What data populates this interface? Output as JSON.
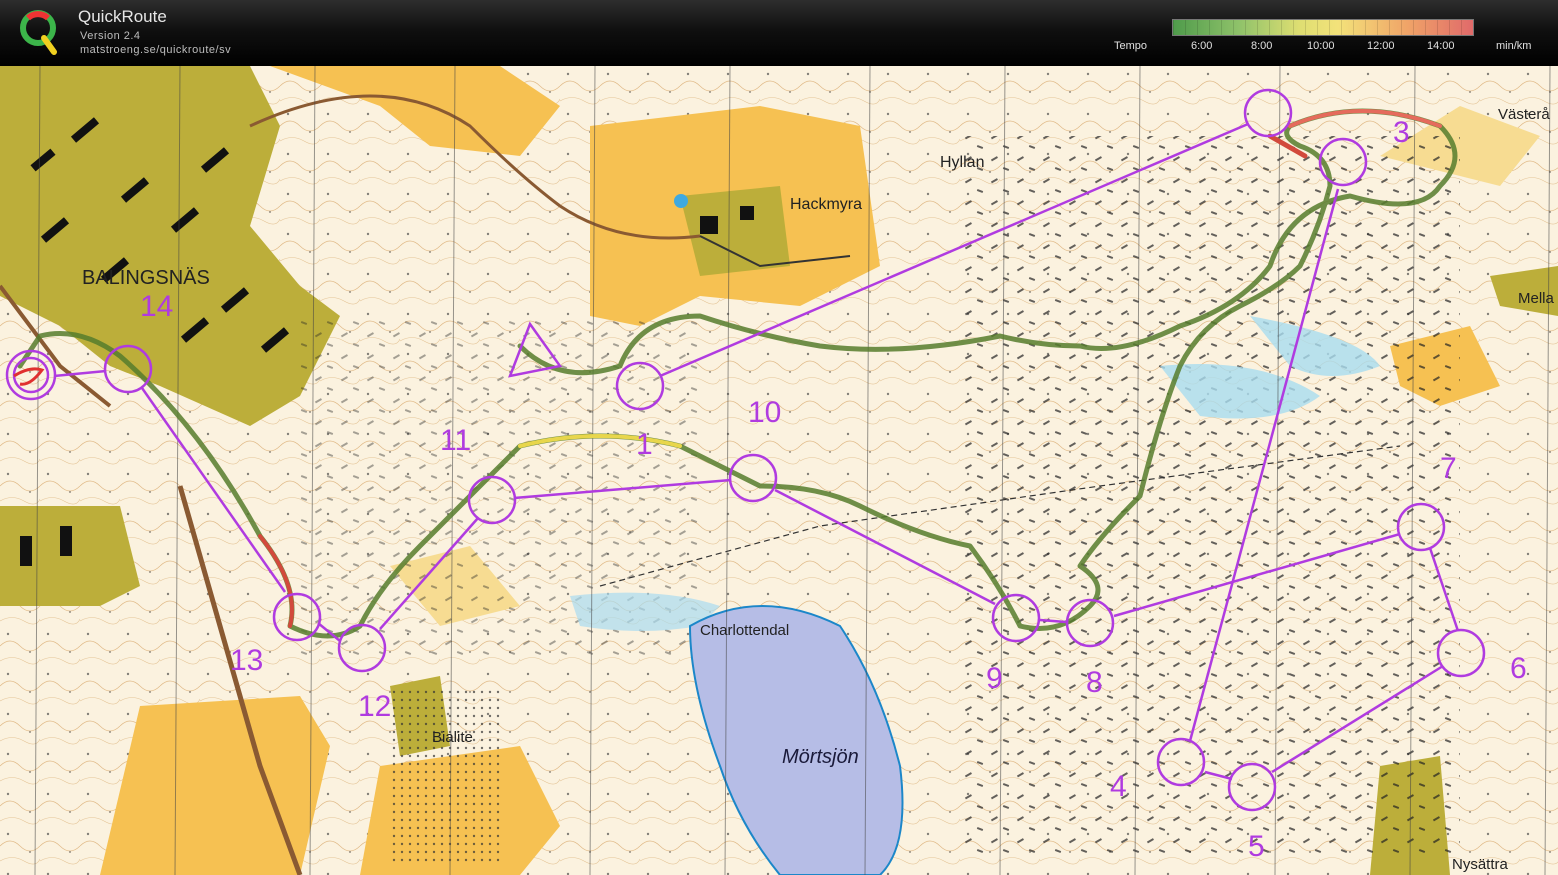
{
  "app": {
    "name": "QuickRoute",
    "version": "Version 2.4",
    "url": "matstroeng.se/quickroute/sv"
  },
  "legend": {
    "title": "Tempo",
    "ticks": [
      "6:00",
      "8:00",
      "10:00",
      "12:00",
      "14:00"
    ],
    "unit": "min/km",
    "colors": {
      "slow": "#e06a6a",
      "mid": "#f3e27a",
      "fast": "#4f9b4b"
    }
  },
  "map": {
    "places": [
      "BALINGSNÄS",
      "Hackmyra",
      "Hyllan",
      "Charlottendal",
      "Mörtsjön",
      "Bialite",
      "Västerå",
      "Mella",
      "Nysättra"
    ],
    "controls": [
      "1",
      "3",
      "4",
      "5",
      "6",
      "7",
      "8",
      "9",
      "10",
      "11",
      "12",
      "13",
      "14"
    ],
    "course_color": "#b03be0"
  }
}
